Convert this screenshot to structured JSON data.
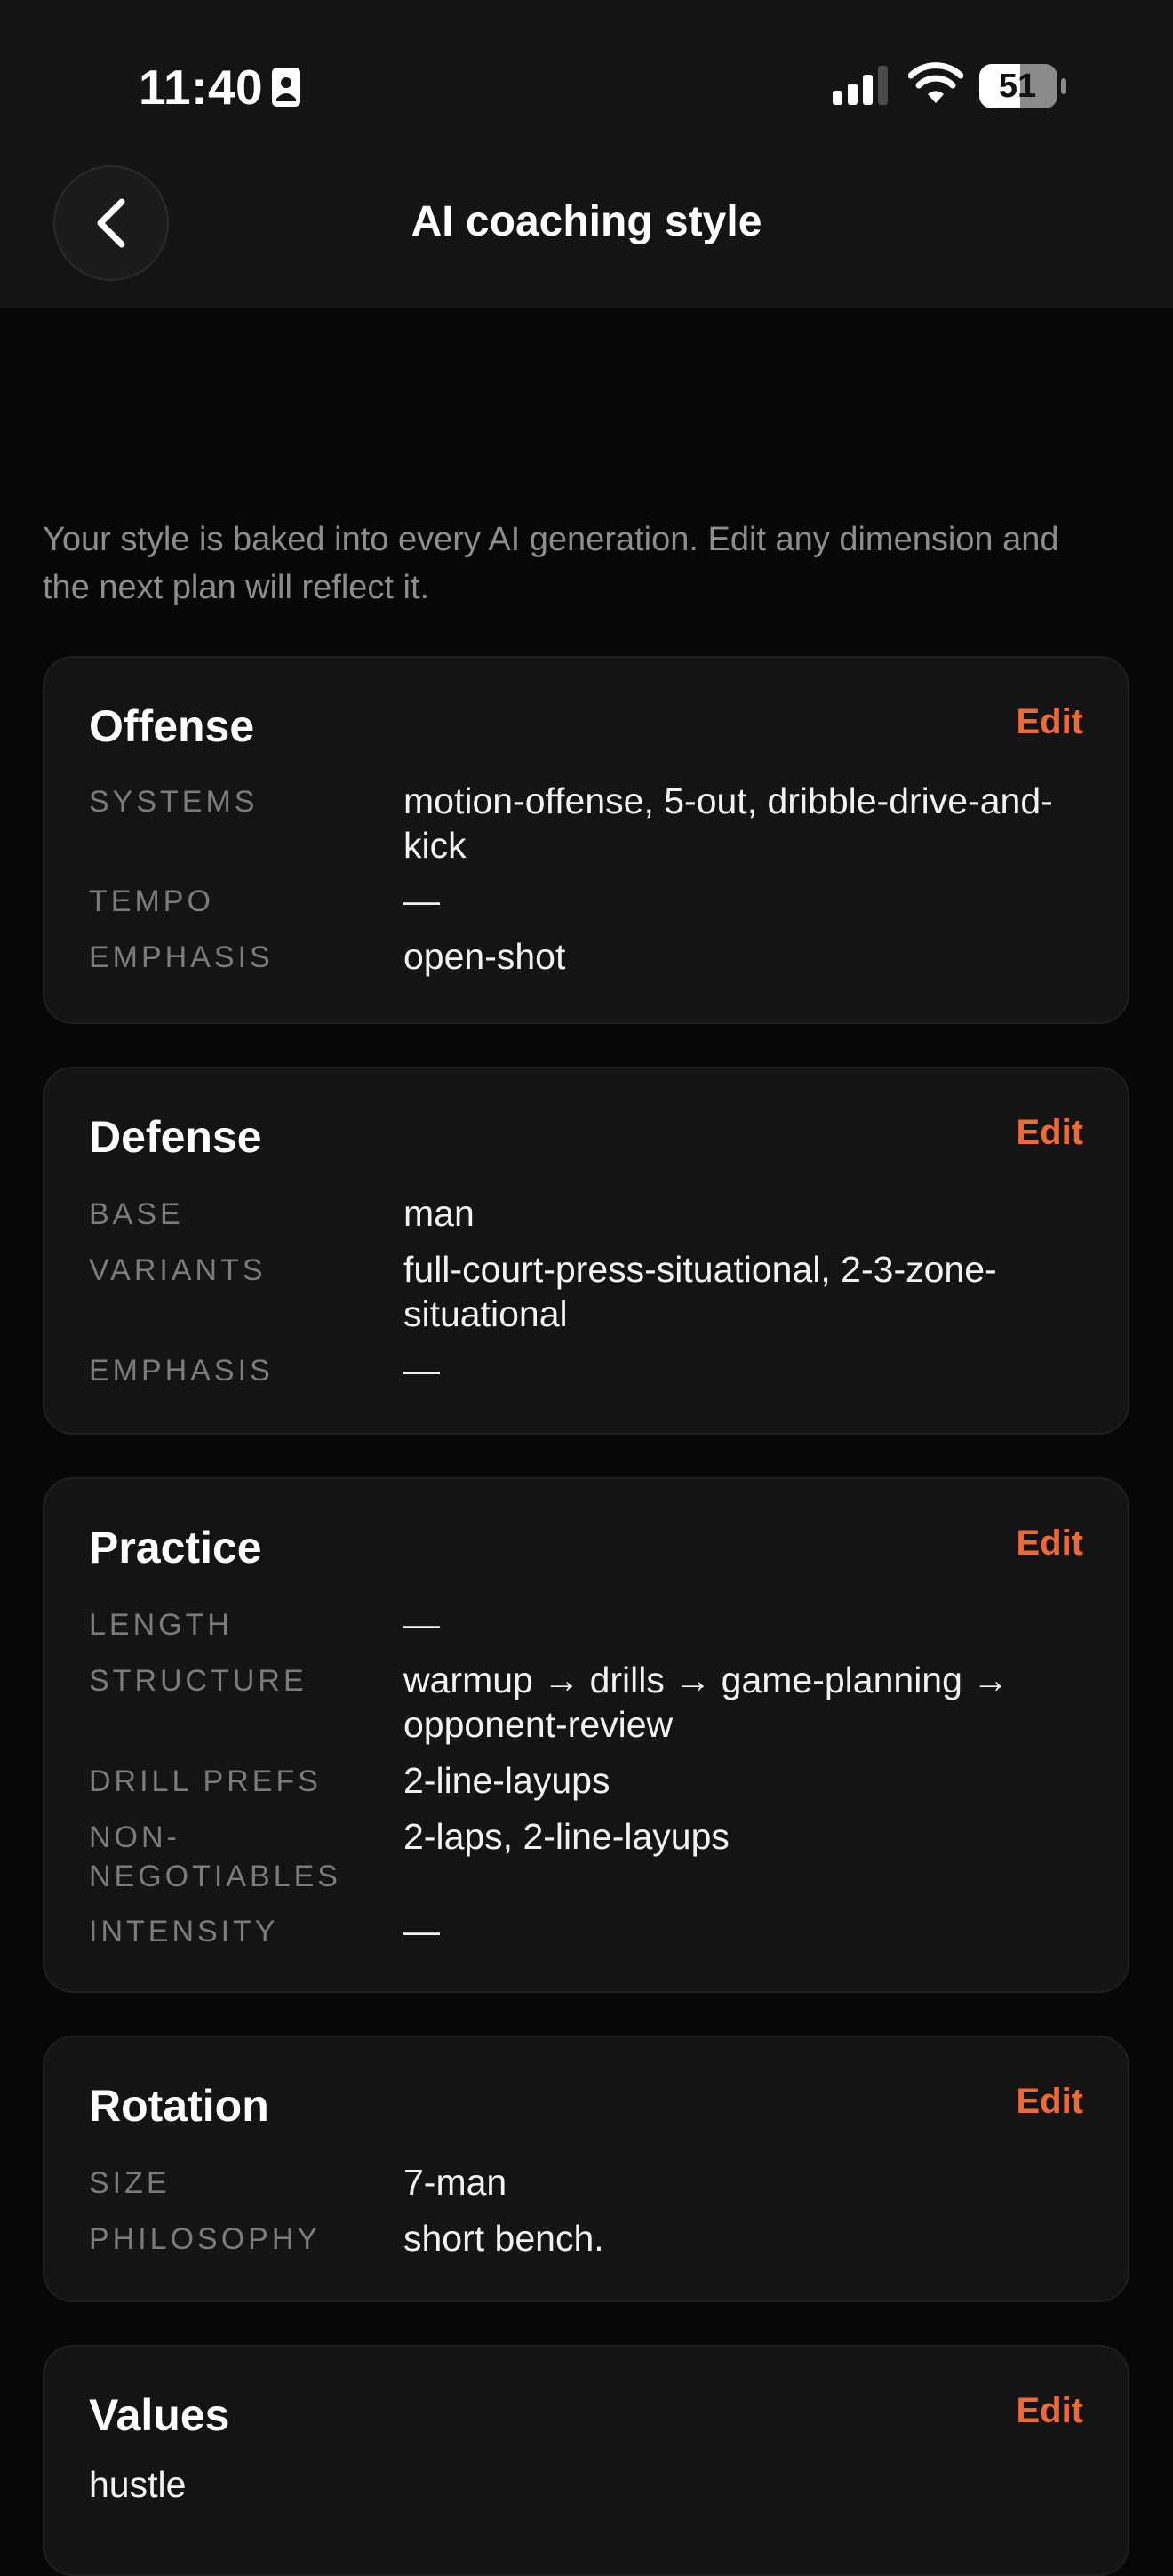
{
  "status_bar": {
    "time": "11:40",
    "battery": "51"
  },
  "header": {
    "title": "AI coaching style"
  },
  "intro": "Your style is baked into every AI generation. Edit any dimension and the next plan will reflect it.",
  "cards": {
    "offense": {
      "title": "Offense",
      "edit": "Edit",
      "rows": [
        {
          "label": "SYSTEMS",
          "value": "motion-offense, 5-out, dribble-drive-and-kick"
        },
        {
          "label": "TEMPO",
          "value": "—"
        },
        {
          "label": "EMPHASIS",
          "value": "open-shot"
        }
      ]
    },
    "defense": {
      "title": "Defense",
      "edit": "Edit",
      "rows": [
        {
          "label": "BASE",
          "value": "man"
        },
        {
          "label": "VARIANTS",
          "value": "full-court-press-situational, 2-3-zone-situational"
        },
        {
          "label": "EMPHASIS",
          "value": "—"
        }
      ]
    },
    "practice": {
      "title": "Practice",
      "edit": "Edit",
      "rows": [
        {
          "label": "LENGTH",
          "value": "—"
        },
        {
          "label": "STRUCTURE",
          "value": "warmup → drills → game-planning → opponent-review"
        },
        {
          "label": "DRILL PREFS",
          "value": "2-line-layups"
        },
        {
          "label": "NON-NEGOTIABLES",
          "value": "2-laps, 2-line-layups"
        },
        {
          "label": "INTENSITY",
          "value": "—"
        }
      ]
    },
    "rotation": {
      "title": "Rotation",
      "edit": "Edit",
      "rows": [
        {
          "label": "SIZE",
          "value": "7-man"
        },
        {
          "label": "PHILOSOPHY",
          "value": "short bench."
        }
      ]
    },
    "values": {
      "title": "Values",
      "edit": "Edit",
      "text": "hustle"
    }
  },
  "colors": {
    "accent": "#ec6a38",
    "background": "#070707",
    "card": "#141414",
    "label": "#7b7b7b"
  }
}
